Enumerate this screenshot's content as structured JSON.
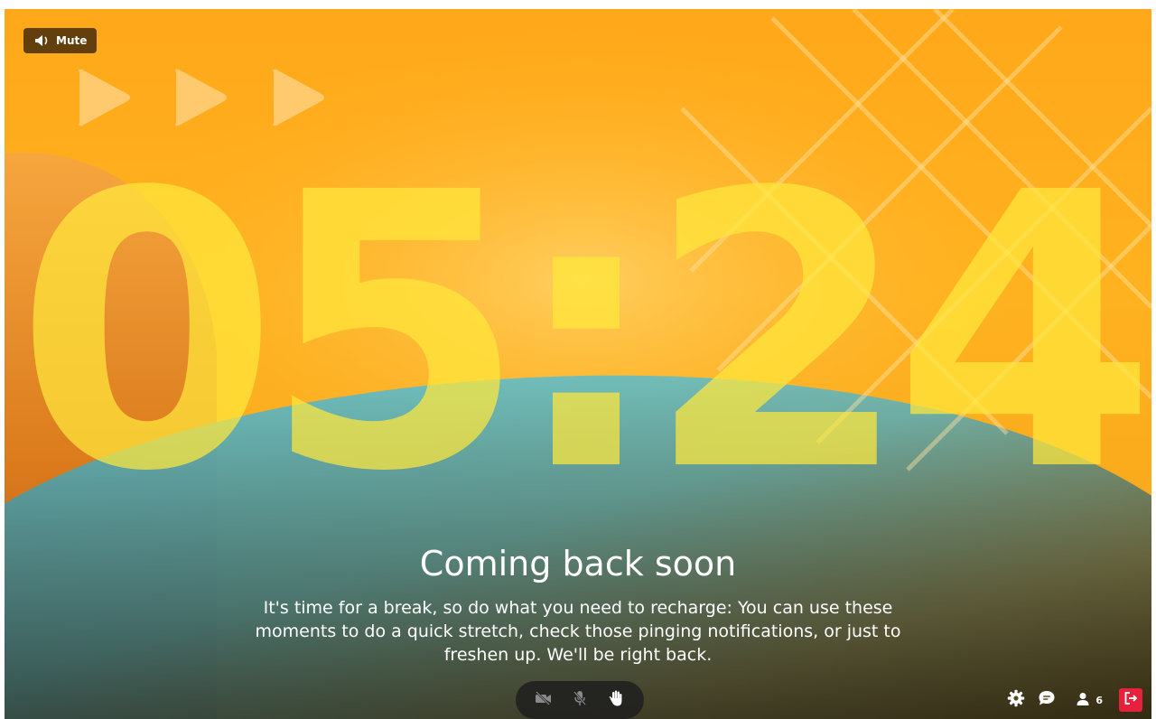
{
  "mute_button": {
    "label": "Mute",
    "icon": "speaker-icon"
  },
  "countdown": {
    "value": "05:24"
  },
  "break_screen": {
    "title": "Coming back soon",
    "message": "It's time for a break, so do what you need to recharge: You can use these moments to do a quick stretch, check those pinging notifications, or just to freshen up. We'll be right back."
  },
  "controls": {
    "camera": {
      "icon": "camera-off-icon",
      "state": "off"
    },
    "microphone": {
      "icon": "microphone-off-icon",
      "state": "off"
    },
    "raise_hand": {
      "icon": "raise-hand-icon"
    }
  },
  "toolbar": {
    "settings_icon": "gear-icon",
    "chat_icon": "chat-icon",
    "participants_icon": "person-icon",
    "participants_count": "6",
    "leave_icon": "leave-icon"
  },
  "colors": {
    "background_orange": "#ffaa1c",
    "curve_teal": "#5fc6cf",
    "countdown_yellow": "#ffe83c",
    "leave_red": "#e5213b",
    "controls_dark": "#1e1e1e"
  }
}
